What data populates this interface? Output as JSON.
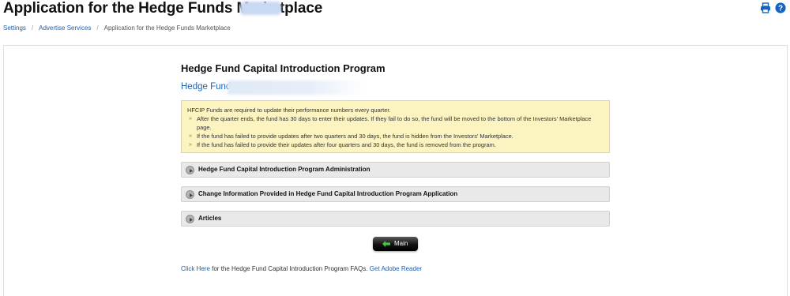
{
  "page": {
    "title": "Application for the Hedge Funds Marketplace"
  },
  "breadcrumb": {
    "items": [
      "Settings",
      "Advertise Services",
      "Application for the Hedge Funds Marketplace"
    ],
    "separator": "/"
  },
  "content": {
    "section_title": "Hedge Fund Capital Introduction Program",
    "fund_label": "Hedge Fund:",
    "notice": {
      "intro": "HFCIP Funds are required to update their performance numbers every quarter.",
      "items": [
        "After the quarter ends, the fund has 30 days to enter their updates. If they fail to do so, the fund will be moved to the bottom of the Investors' Marketplace page.",
        "If the fund has failed to provide updates after two quarters and 30 days, the fund is hidden from the Investors' Marketplace.",
        "If the fund has failed to provide their updates after four quarters and 30 days, the fund is removed from the program."
      ]
    },
    "accordions": [
      "Hedge Fund Capital Introduction Program Administration",
      "Change Information Provided in Hedge Fund Capital Introduction Program Application",
      "Articles"
    ],
    "main_button": "Main",
    "footer": {
      "click_here": "Click Here",
      "text": " for the Hedge Fund Capital Introduction Program FAQs. ",
      "adobe_link": "Get Adobe Reader"
    }
  },
  "colors": {
    "link": "#1a5fb4",
    "notice_bg": "#fbf3c0",
    "notice_border": "#e3d58a",
    "accordion_bg": "#e9e9e9",
    "icon_blue": "#1565c0"
  },
  "icons": {
    "print": "print-icon",
    "help": "help-icon",
    "accordion": "expand-arrow-icon",
    "back": "back-arrow-icon"
  }
}
